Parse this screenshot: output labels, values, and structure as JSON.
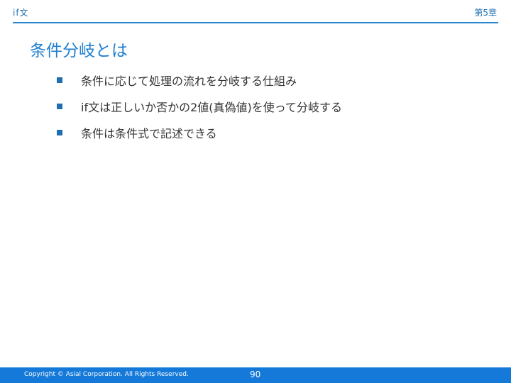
{
  "header": {
    "section": "if文",
    "chapter": "第5章"
  },
  "slide": {
    "title": "条件分岐とは",
    "bullets": [
      "条件に応じて処理の流れを分岐する仕組み",
      "if文は正しいか否かの2値(真偽値)を使って分岐する",
      "条件は条件式で記述できる"
    ]
  },
  "footer": {
    "copyright": "Copyright © Asial Corporation. All Rights Reserved.",
    "page_number": "90"
  },
  "colors": {
    "accent": "#1f7fd0",
    "footer_bg": "#1479d9",
    "bullet": "#1f6fb0"
  }
}
